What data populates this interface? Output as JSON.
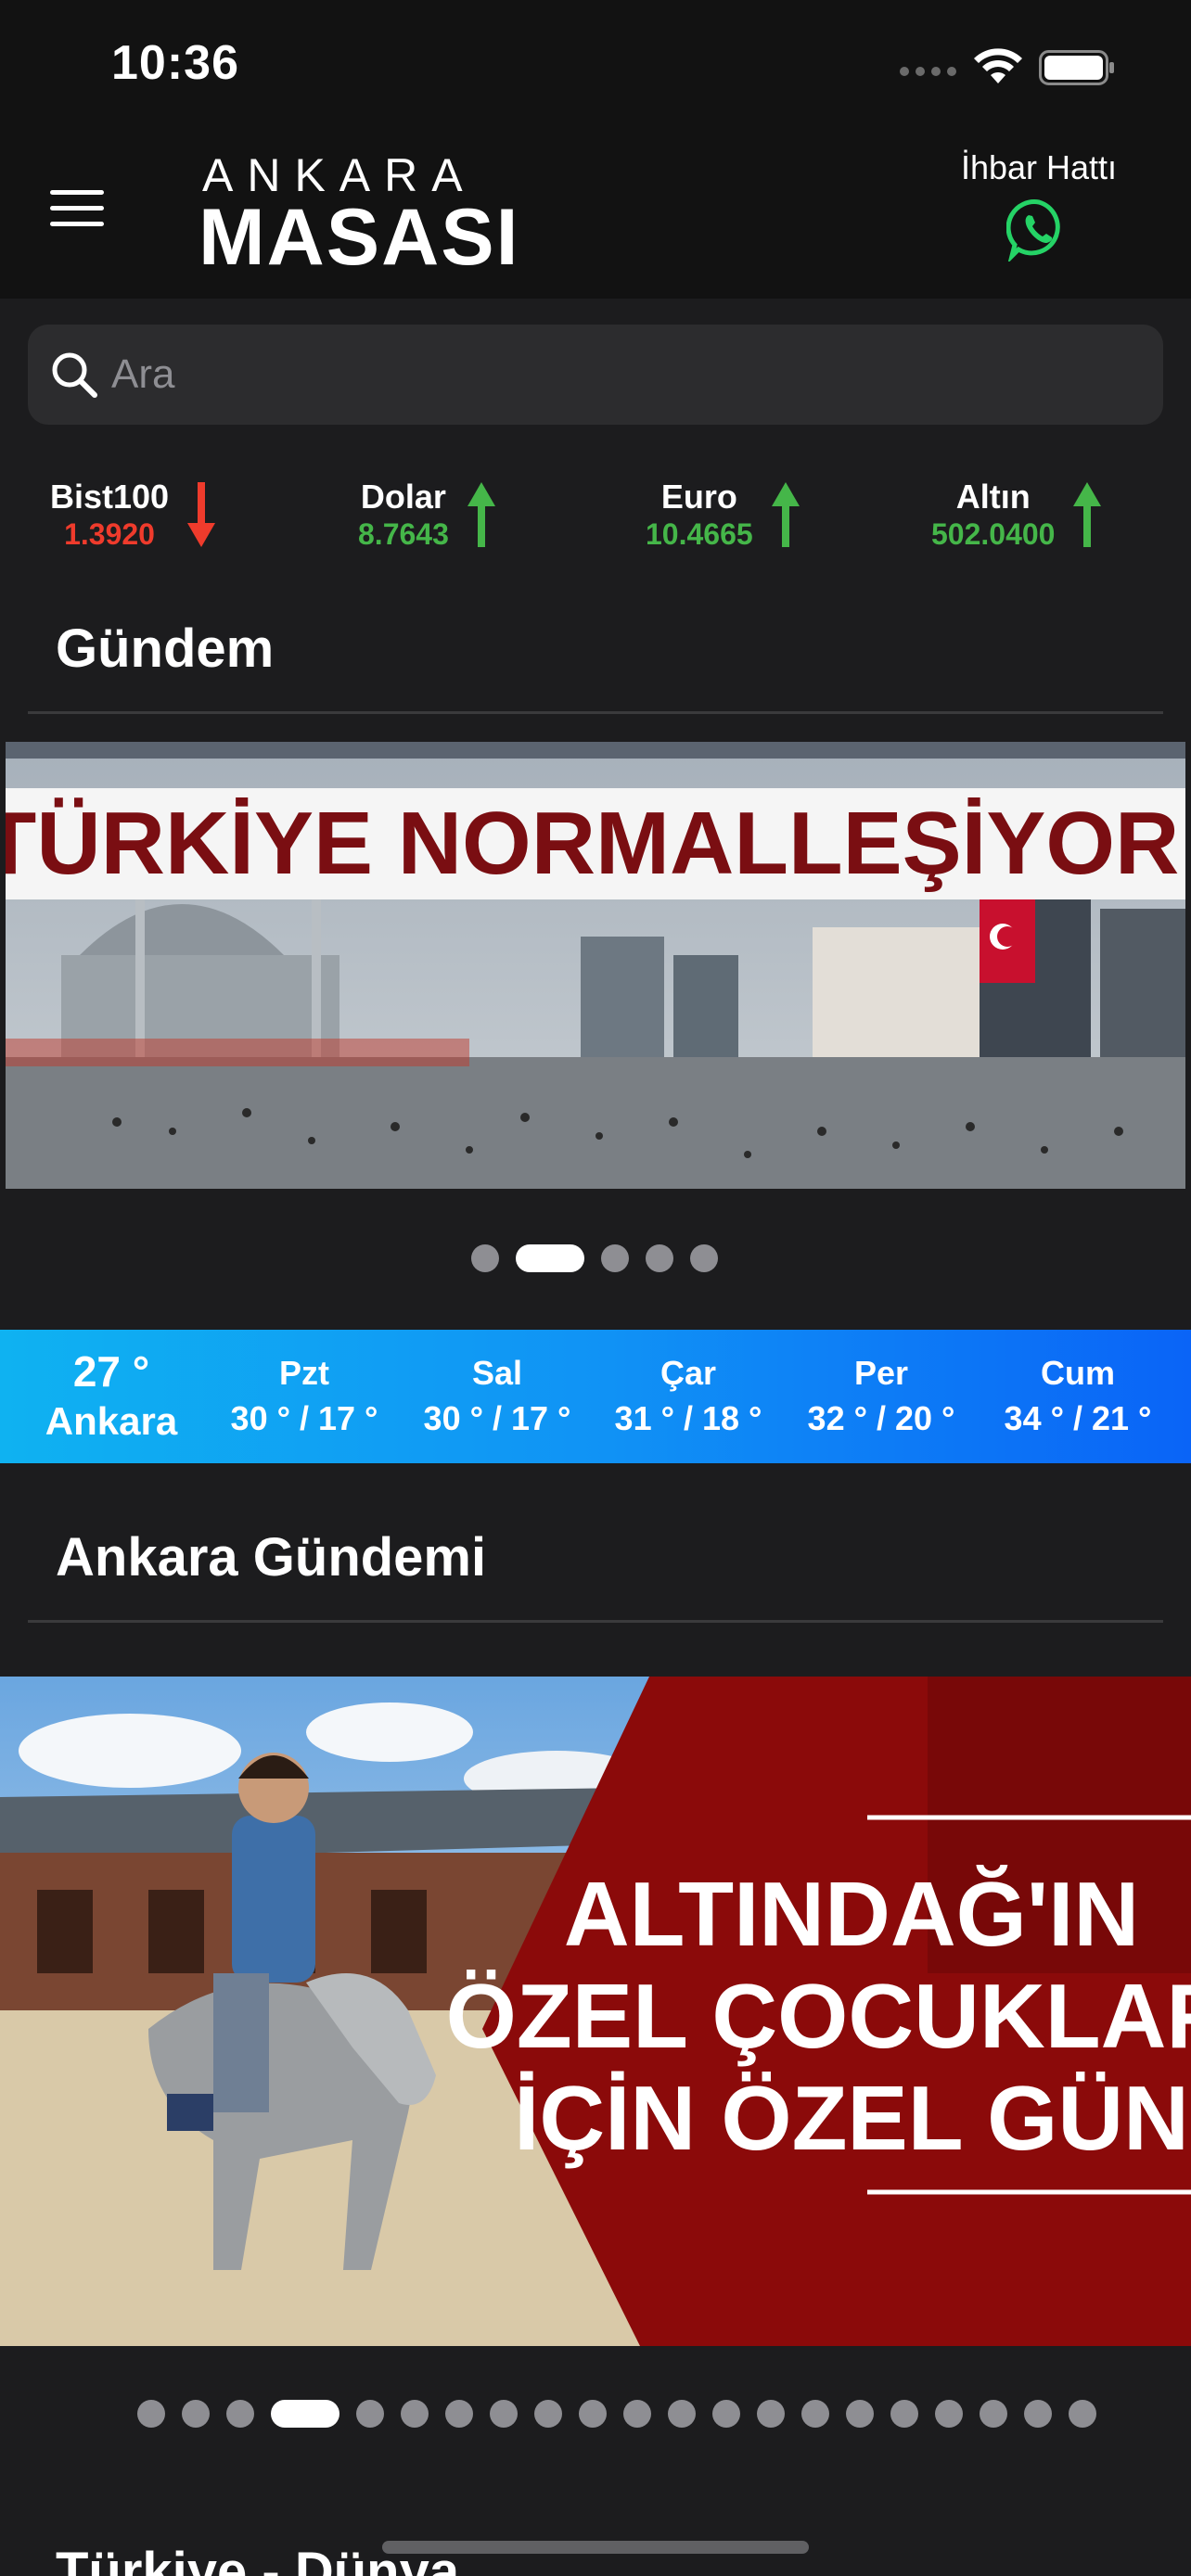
{
  "status_bar": {
    "time": "10:36"
  },
  "header": {
    "logo_top": "ANKARA",
    "logo_bottom": "MASASI",
    "tip_line_label": "İhbar Hattı"
  },
  "search": {
    "placeholder": "Ara"
  },
  "tickers": [
    {
      "name": "Bist100",
      "value": "1.3920",
      "trend": "down"
    },
    {
      "name": "Dolar",
      "value": "8.7643",
      "trend": "up"
    },
    {
      "name": "Euro",
      "value": "10.4665",
      "trend": "up"
    },
    {
      "name": "Altın",
      "value": "502.0400",
      "trend": "up"
    }
  ],
  "sections": {
    "gundem": "Gündem",
    "ankara_gundemi": "Ankara Gündemi",
    "next": "Türkiye - Dünya"
  },
  "banner1": {
    "headline": "TÜRKİYE NORMALLEŞİYOR!",
    "dot_count": 5,
    "active_index": 1
  },
  "banner2": {
    "headline_lines": [
      "ALTINDAĞ'IN",
      "ÖZEL ÇOCUKLARI",
      "İÇİN ÖZEL GÜN"
    ],
    "dot_count": 21,
    "active_index": 3
  },
  "weather": {
    "current_temp": "27 °",
    "city": "Ankara",
    "forecast": [
      {
        "day": "Pzt",
        "range": "30 ° / 17 °"
      },
      {
        "day": "Sal",
        "range": "30 ° / 17 °"
      },
      {
        "day": "Çar",
        "range": "31 ° / 18 °"
      },
      {
        "day": "Per",
        "range": "32 ° / 20 °"
      },
      {
        "day": "Cum",
        "range": "34 ° / 21 °"
      }
    ]
  },
  "colors": {
    "down": "#ef3b2c",
    "up": "#45b649",
    "whatsapp": "#25d366",
    "banner_red": "#8b0a0a"
  }
}
